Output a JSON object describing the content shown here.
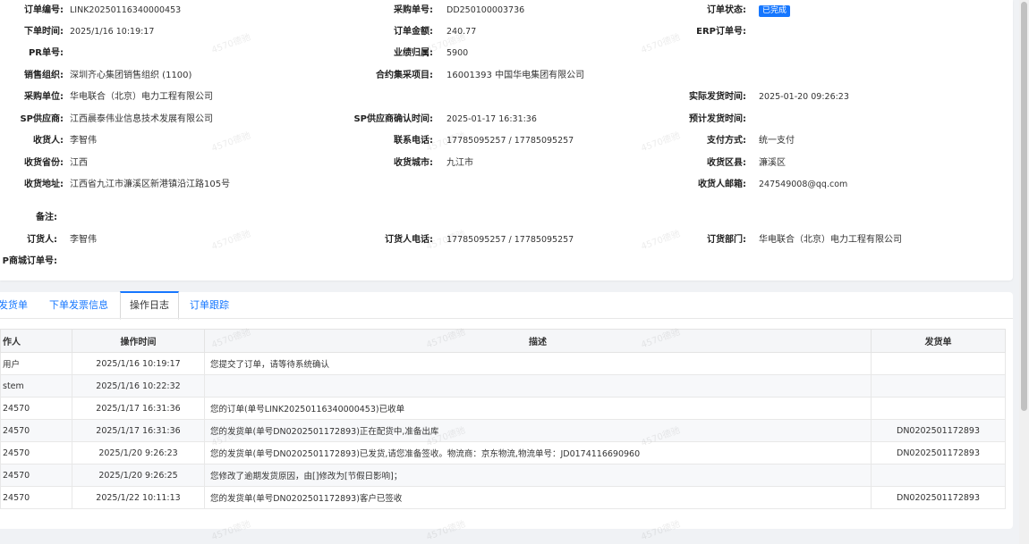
{
  "order": {
    "order_no_label": "订单编号:",
    "order_no": "LINK20250116340000453",
    "purchase_no_label": "采购单号:",
    "purchase_no": "DD250100003736",
    "status_label": "订单状态:",
    "status": "已完成",
    "order_time_label": "下单时间:",
    "order_time": "2025/1/16 10:19:17",
    "amount_label": "订单金额:",
    "amount": "240.77",
    "erp_label": "ERP订单号:",
    "erp": "",
    "pr_label": "PR单号:",
    "pr": "",
    "perf_label": "业绩归属:",
    "perf": "5900",
    "sales_org_label": "销售组织:",
    "sales_org": "深圳齐心集团销售组织 (1100)",
    "contract_label": "合约集采项目:",
    "contract": "16001393 中国华电集团有限公司",
    "buyer_label": "采购单位:",
    "buyer": "华电联合（北京）电力工程有限公司",
    "ship_time_label": "实际发货时间:",
    "ship_time": "2025-01-20 09:26:23",
    "sp_label": "SP供应商:",
    "sp": "江西晨泰伟业信息技术发展有限公司",
    "sp_confirm_label": "SP供应商确认时间:",
    "sp_confirm": "2025-01-17 16:31:36",
    "est_ship_label": "预计发货时间:",
    "est_ship": "",
    "receiver_label": "收货人:",
    "receiver": "李智伟",
    "phone_label": "联系电话:",
    "phone": "17785095257 / 17785095257",
    "pay_label": "支付方式:",
    "pay": "统一支付",
    "province_label": "收货省份:",
    "province": "江西",
    "city_label": "收货城市:",
    "city": "九江市",
    "district_label": "收货区县:",
    "district": "濂溪区",
    "address_label": "收货地址:",
    "address": "江西省九江市濂溪区新港镇沿江路105号",
    "email_label": "收货人邮箱:",
    "email": "247549008@qq.com",
    "remark_label": "备注:",
    "remark": "",
    "orderer_label": "订货人:",
    "orderer": "李智伟",
    "orderer_phone_label": "订货人电话:",
    "orderer_phone": "17785095257 / 17785095257",
    "dept_label": "订货部门:",
    "dept": "华电联合（北京）电力工程有限公司",
    "mall_label": "P商城订单号:",
    "mall": ""
  },
  "tabs": [
    "发货单",
    "下单发票信息",
    "操作日志",
    "订单跟踪"
  ],
  "log": {
    "headers": [
      "作人",
      "操作时间",
      "描述",
      "发货单"
    ],
    "rows": [
      {
        "user": "用户",
        "time": "2025/1/16 10:19:17",
        "desc": "您提交了订单，请等待系统确认",
        "dn": ""
      },
      {
        "user": "stem",
        "time": "2025/1/16 10:22:32",
        "desc": "",
        "dn": ""
      },
      {
        "user": "24570",
        "time": "2025/1/17 16:31:36",
        "desc": "您的订单(单号LINK20250116340000453)已收单",
        "dn": ""
      },
      {
        "user": "24570",
        "time": "2025/1/17 16:31:36",
        "desc": "您的发货单(单号DN0202501172893)正在配货中,准备出库",
        "dn": "DN0202501172893"
      },
      {
        "user": "24570",
        "time": "2025/1/20 9:26:23",
        "desc": "您的发货单(单号DN0202501172893)已发货,请您准备签收。物流商：京东物流,物流单号：JD0174116690960",
        "dn": "DN0202501172893"
      },
      {
        "user": "24570",
        "time": "2025/1/20 9:26:25",
        "desc": "您修改了逾期发货原因，由[]修改为[节假日影响]；",
        "dn": ""
      },
      {
        "user": "24570",
        "time": "2025/1/22 10:11:13",
        "desc": "您的发货单(单号DN0202501172893)客户已签收",
        "dn": "DN0202501172893"
      }
    ]
  },
  "watermark": "4570德驰"
}
